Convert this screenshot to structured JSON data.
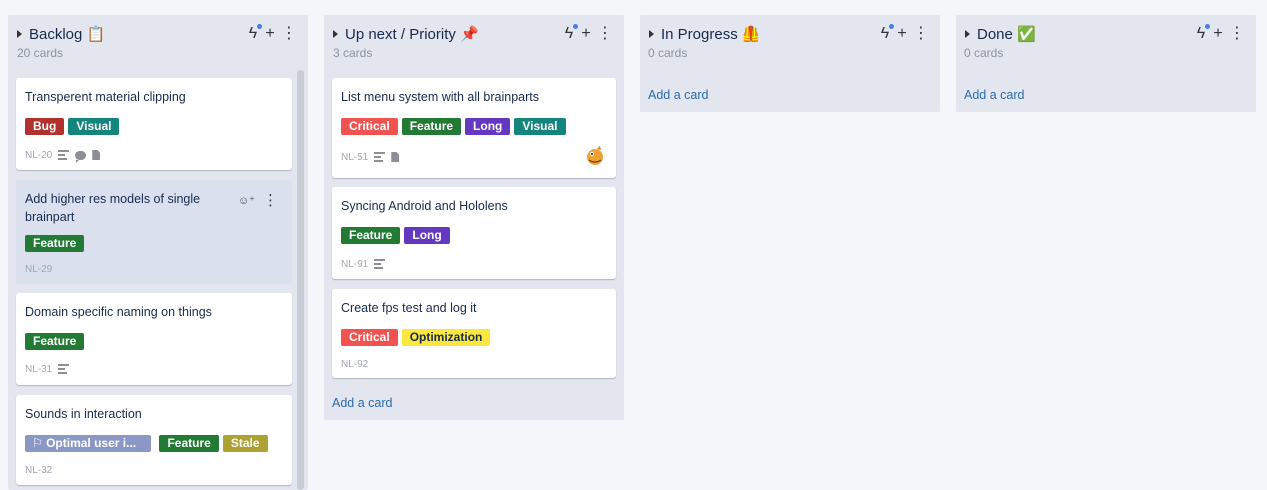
{
  "lists": [
    {
      "title": "Backlog 📋",
      "count": "20 cards",
      "cards": [
        {
          "title": "Transperent material clipping",
          "labels": [
            "Bug",
            "Visual"
          ],
          "id": "NL-20"
        },
        {
          "title": "Add higher res models of single brainpart",
          "labels": [
            "Feature"
          ],
          "id": "NL-29"
        },
        {
          "title": "Domain specific naming on things",
          "labels": [
            "Feature"
          ],
          "id": "NL-31"
        },
        {
          "title": "Sounds in interaction",
          "labels": [
            "⚐ Optimal user i...",
            "Feature",
            "Stale"
          ],
          "id": "NL-32"
        }
      ]
    },
    {
      "title": "Up next / Priority 📌",
      "count": "3 cards",
      "cards": [
        {
          "title": "List menu system with all brainparts",
          "labels": [
            "Critical",
            "Feature",
            "Long",
            "Visual"
          ],
          "id": "NL-51"
        },
        {
          "title": "Syncing Android and Hololens",
          "labels": [
            "Feature",
            "Long"
          ],
          "id": "NL-91"
        },
        {
          "title": "Create fps test and log it",
          "labels": [
            "Critical",
            "Optimization"
          ],
          "id": "NL-92"
        }
      ],
      "add_card": "Add a card"
    },
    {
      "title": "In Progress 🦺",
      "count": "0 cards",
      "add_card": "Add a card"
    },
    {
      "title": "Done ✅",
      "count": "0 cards",
      "add_card": "Add a card"
    }
  ],
  "label_colors": {
    "Bug": "#b0322f",
    "Visual": "#13857d",
    "Feature": "#237a35",
    "Critical": "#f25250",
    "Long": "#6438c1",
    "Optimization": "#fce73e",
    "Stale": "#ada132",
    "Optimal user": "#8b97c5"
  },
  "icons": {
    "automation": "bolt-icon",
    "add": "plus-icon",
    "menu": "kebab-menu-icon",
    "description": "description-icon",
    "comments": "comment-icon",
    "attachment": "attachment-icon",
    "add_member": "add-member-icon",
    "avatar": "avatar-dragon"
  }
}
